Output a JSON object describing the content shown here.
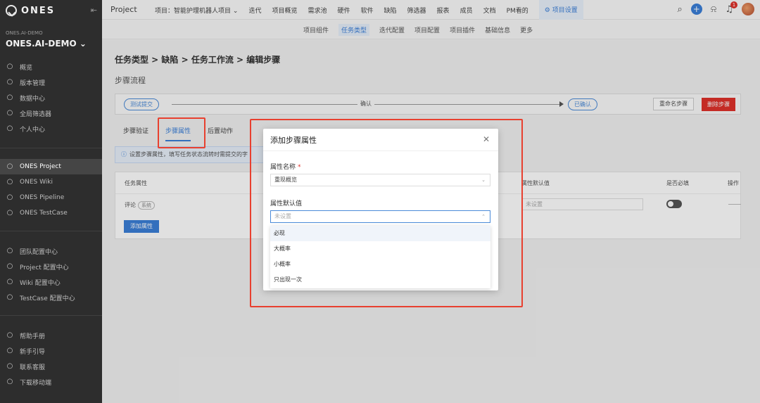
{
  "sidebar": {
    "brand": "ONES",
    "org_small": "ONES.AI-DEMO",
    "org_name": "ONES.AI-DEMO",
    "group1": [
      {
        "label": "概览",
        "icon": "dashboard-icon"
      },
      {
        "label": "版本管理",
        "icon": "version-icon"
      },
      {
        "label": "数据中心",
        "icon": "chart-icon"
      },
      {
        "label": "全局筛选器",
        "icon": "filter-icon"
      },
      {
        "label": "个人中心",
        "icon": "user-icon"
      }
    ],
    "group2": [
      {
        "label": "ONES Project",
        "icon": "project-icon",
        "active": true
      },
      {
        "label": "ONES Wiki",
        "icon": "wiki-icon"
      },
      {
        "label": "ONES Pipeline",
        "icon": "pipeline-icon"
      },
      {
        "label": "ONES TestCase",
        "icon": "testcase-icon"
      }
    ],
    "group3": [
      {
        "label": "团队配置中心",
        "icon": "team-icon"
      },
      {
        "label": "Project 配置中心",
        "icon": "settings-icon"
      },
      {
        "label": "Wiki 配置中心",
        "icon": "wiki-settings-icon"
      },
      {
        "label": "TestCase 配置中心",
        "icon": "testcase-settings-icon"
      }
    ],
    "group4": [
      {
        "label": "帮助手册",
        "icon": "help-icon"
      },
      {
        "label": "新手引导",
        "icon": "guide-icon"
      },
      {
        "label": "联系客服",
        "icon": "support-icon"
      },
      {
        "label": "下载移动端",
        "icon": "mobile-icon"
      }
    ]
  },
  "topbar": {
    "title": "Project",
    "project_selector": "项目：智能护理机器人项目",
    "nav": [
      "迭代",
      "项目概览",
      "需求池",
      "硬件",
      "软件",
      "缺陷",
      "筛选器",
      "报表",
      "成员",
      "文档",
      "PM看的"
    ],
    "active_nav": "项目设置",
    "badge_count": "1"
  },
  "subnav": {
    "items": [
      "项目组件",
      "任务类型",
      "迭代配置",
      "项目配置",
      "项目插件",
      "基础信息",
      "更多"
    ],
    "active_index": 1
  },
  "main": {
    "breadcrumb": "任务类型 > 缺陷 > 任务工作流 > 编辑步骤",
    "section_title": "步骤流程",
    "flow": {
      "from": "测试提交",
      "action": "确认",
      "to": "已确认",
      "rename_btn": "重命名步骤",
      "delete_btn": "删除步骤"
    },
    "tabs": [
      "步骤验证",
      "步骤属性",
      "后置动作"
    ],
    "active_tab": 1,
    "info": "设置步骤属性，填写任务状态流转时需提交的字",
    "table": {
      "headers": {
        "attr": "任务属性",
        "default": "属性默认值",
        "required": "是否必填",
        "action": "操作"
      },
      "row": {
        "attr": "评论",
        "tag": "系统",
        "default_placeholder": "未设置"
      },
      "add_btn": "添加属性"
    }
  },
  "modal": {
    "title": "添加步骤属性",
    "field1_label": "属性名称",
    "field1_value": "重现概览",
    "field2_label": "属性默认值",
    "field2_placeholder": "未设置",
    "options": [
      "必现",
      "大概率",
      "小概率",
      "只出现一次"
    ],
    "highlighted_option": 0
  },
  "colors": {
    "accent": "#3b7fd8",
    "danger": "#e0312b",
    "sidebar_bg": "#2d2d2d",
    "annotation": "#e8402f"
  }
}
